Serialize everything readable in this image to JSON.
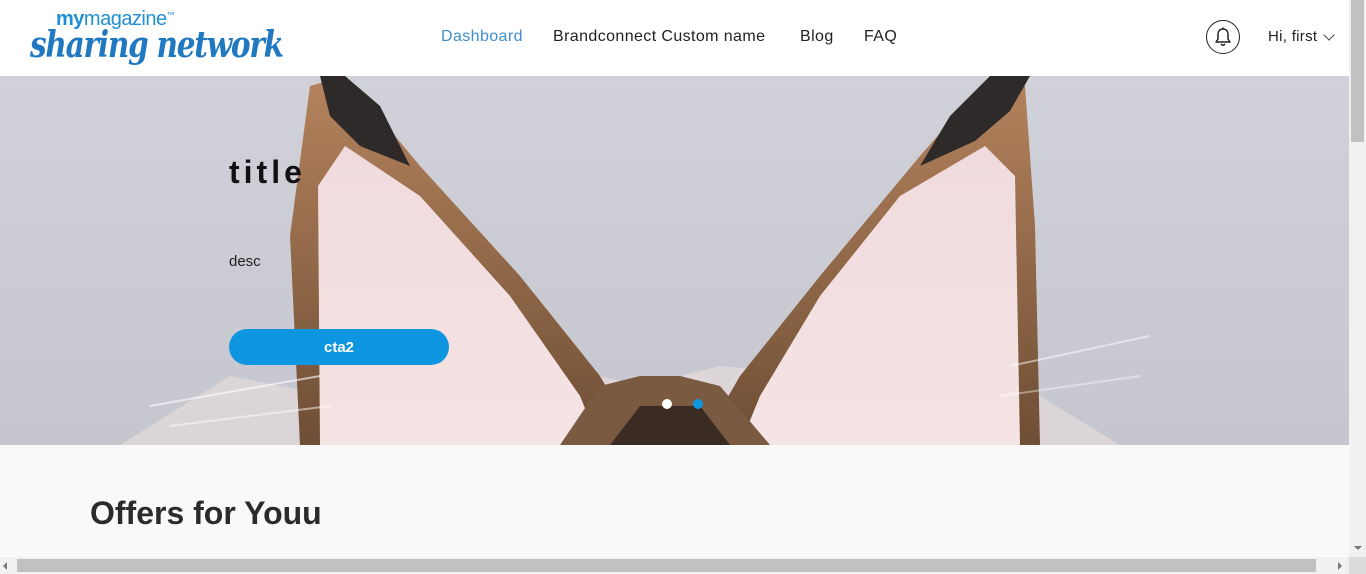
{
  "header": {
    "logo_top_bold": "my",
    "logo_top_rest": "magazine",
    "logo_tm": "™",
    "logo_bottom": "sharing network",
    "nav": [
      {
        "label": "Dashboard",
        "active": true
      },
      {
        "label": "Brandconnect Custom name",
        "active": false
      },
      {
        "label": "Blog",
        "active": false
      },
      {
        "label": "FAQ",
        "active": false
      }
    ],
    "notifications_icon": "bell-icon",
    "user_greeting": "Hi, first"
  },
  "hero": {
    "title": "title",
    "description": "desc",
    "cta_label": "cta2",
    "slides": 2,
    "active_slide": 1,
    "background": "cat-ears-photo"
  },
  "offers": {
    "title": "Offers for Youu"
  },
  "colors": {
    "accent": "#0e96e0",
    "nav_active": "#3d8fd0",
    "logo": "#1f78c0"
  }
}
